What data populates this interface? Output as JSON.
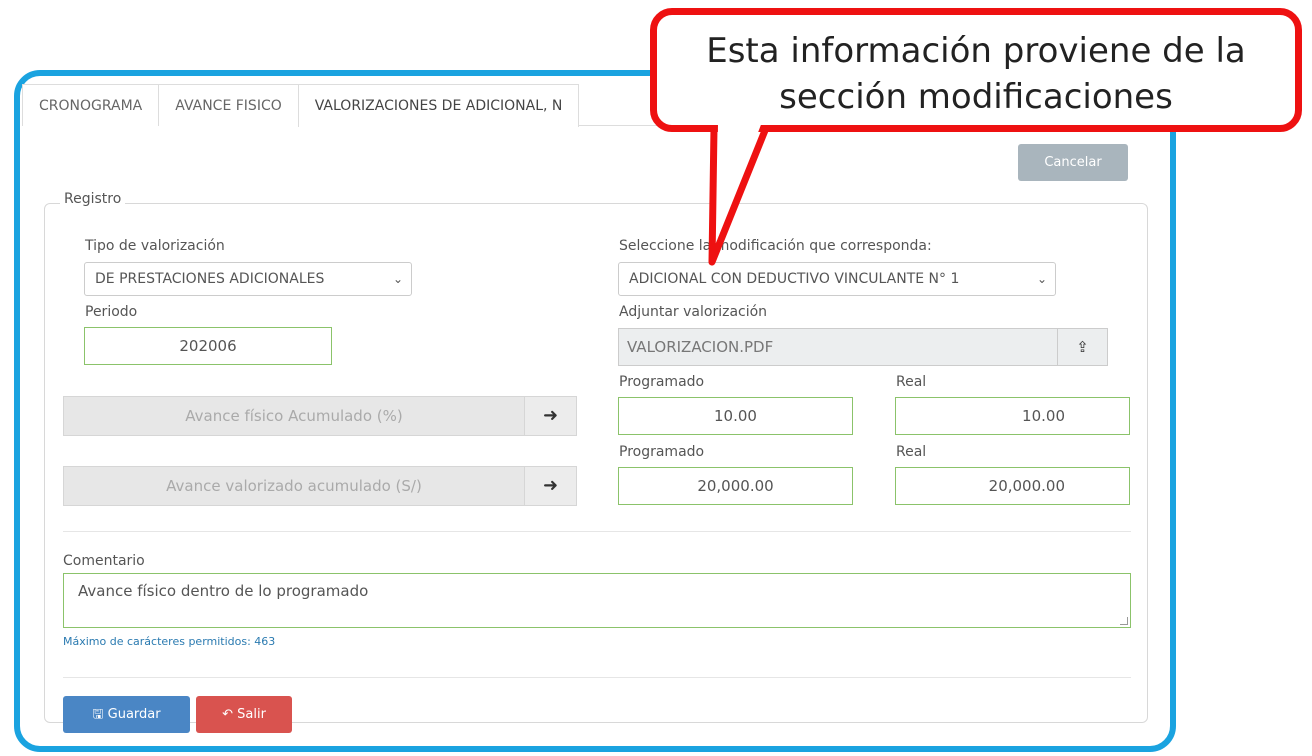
{
  "tabs": [
    {
      "label": "CRONOGRAMA"
    },
    {
      "label": "AVANCE FISICO"
    },
    {
      "label": "VALORIZACIONES DE ADICIONAL, N"
    }
  ],
  "cancel_label": "Cancelar",
  "registro": {
    "legend": "Registro",
    "tipo_label": "Tipo de valorización",
    "tipo_value": "DE PRESTACIONES ADICIONALES",
    "modif_label": "Seleccione la modificación que corresponda:",
    "modif_value": "ADICIONAL CON DEDUCTIVO VINCULANTE N° 1",
    "periodo_label": "Periodo",
    "periodo_value": "202006",
    "adjuntar_label": "Adjuntar valorización",
    "adjuntar_value": "VALORIZACION.PDF",
    "fisico": {
      "button": "Avance físico Acumulado (%)",
      "programado_label": "Programado",
      "real_label": "Real",
      "programado": "10.00",
      "real": "10.00"
    },
    "valorizado": {
      "button": "Avance valorizado acumulado (S/)",
      "programado_label": "Programado",
      "real_label": "Real",
      "programado": "20,000.00",
      "real": "20,000.00"
    },
    "comentario_label": "Comentario",
    "comentario_value": "Avance físico dentro de lo programado",
    "hint": "Máximo de carácteres permitidos: 463"
  },
  "actions": {
    "save": "Guardar",
    "exit": "Salir"
  },
  "callout": {
    "line1": "Esta información proviene de la",
    "line2": "sección modificaciones"
  },
  "colors": {
    "frame": "#1aa3e0",
    "callout_border": "#ee1111",
    "save": "#4a86c5",
    "exit": "#d9534f",
    "input_border": "#8bc36a"
  }
}
